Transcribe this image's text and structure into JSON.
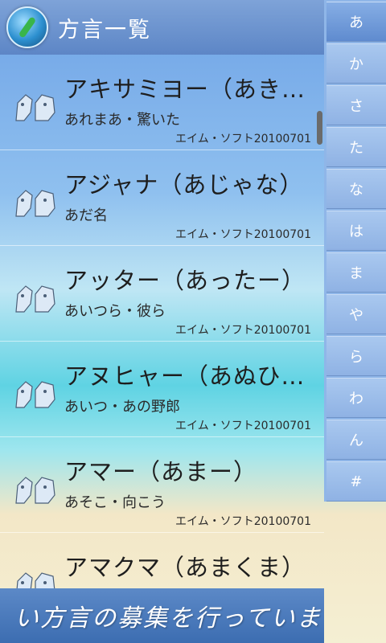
{
  "header": {
    "title": "方言一覧"
  },
  "entries": [
    {
      "title": "アキサミヨー（あき…",
      "meaning": "あれまあ・驚いた",
      "credit": "エイム・ソフト20100701"
    },
    {
      "title": "アジャナ（あじゃな）",
      "meaning": "あだ名",
      "credit": "エイム・ソフト20100701"
    },
    {
      "title": "アッター（あったー）",
      "meaning": "あいつら・彼ら",
      "credit": "エイム・ソフト20100701"
    },
    {
      "title": "アヌヒャー（あぬひ…",
      "meaning": "あいつ・あの野郎",
      "credit": "エイム・ソフト20100701"
    },
    {
      "title": "アマー（あまー）",
      "meaning": "あそこ・向こう",
      "credit": "エイム・ソフト20100701"
    },
    {
      "title": "アマクマ（あまくま）",
      "meaning": "",
      "credit": ""
    }
  ],
  "index": [
    "あ",
    "か",
    "さ",
    "た",
    "な",
    "は",
    "ま",
    "や",
    "ら",
    "わ",
    "ん",
    "#"
  ],
  "banner": {
    "text": "い方言の募集を行っていま"
  }
}
